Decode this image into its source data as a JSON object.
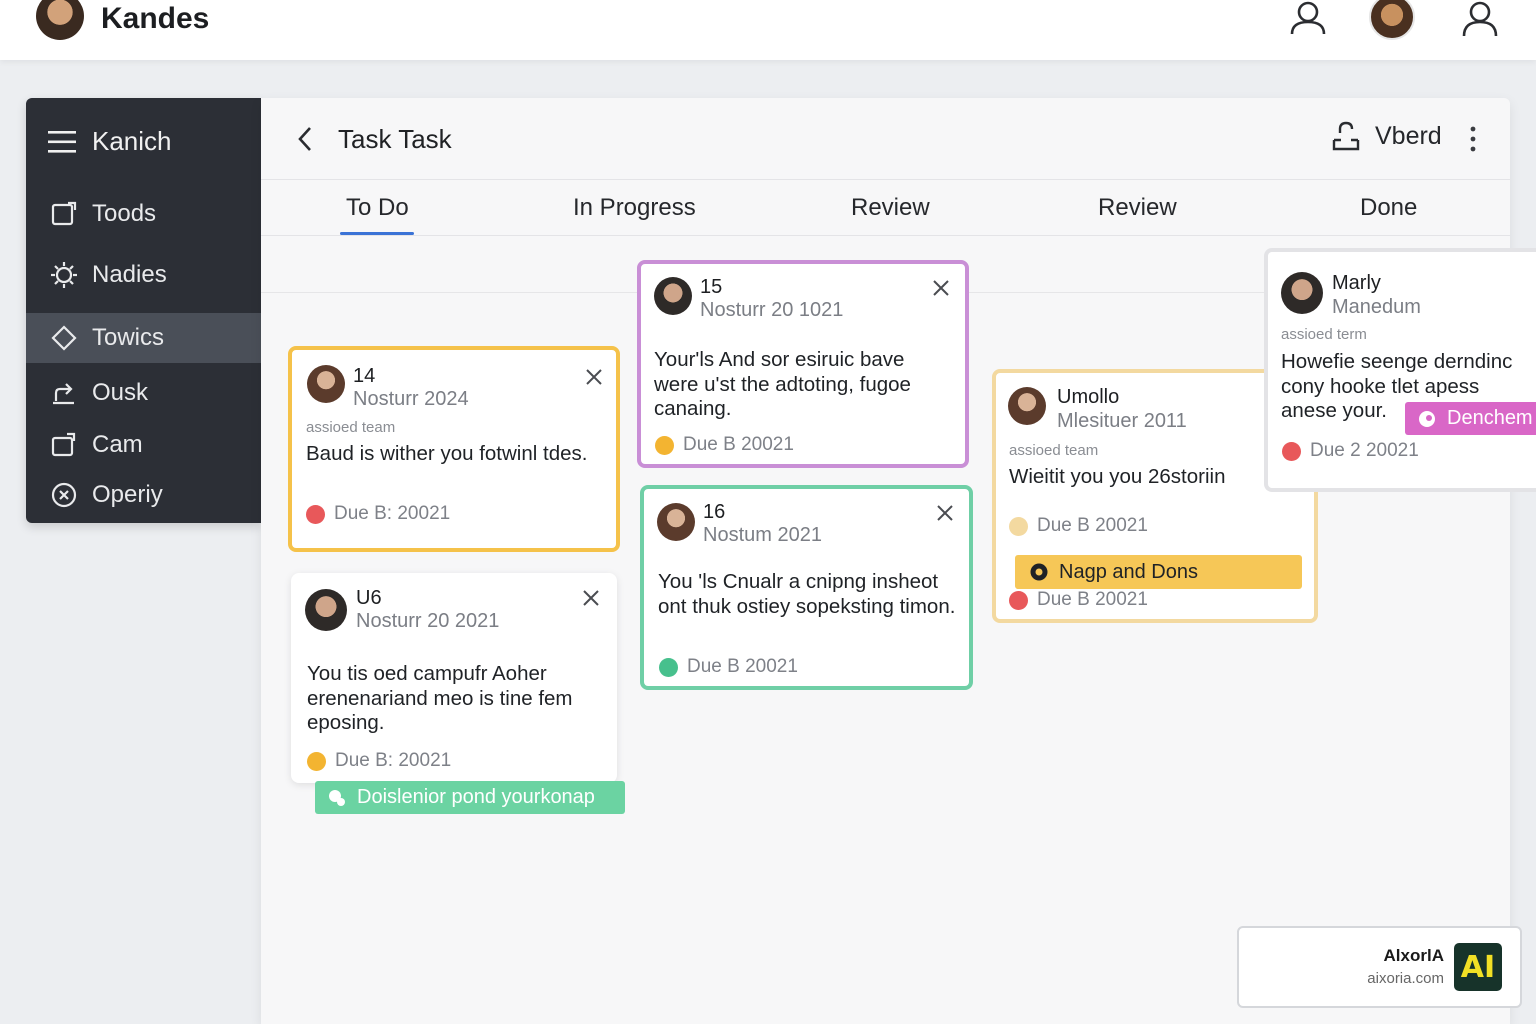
{
  "app": {
    "brand": "Kandes"
  },
  "sidebar": {
    "title": "Kanich",
    "items": [
      {
        "label": "Toods",
        "icon": "edit-icon"
      },
      {
        "label": "Nadies",
        "icon": "gear-icon"
      },
      {
        "label": "Towics",
        "icon": "diamond-icon",
        "active": true
      },
      {
        "label": "Ousk",
        "icon": "share-icon"
      },
      {
        "label": "Cam",
        "icon": "edit-icon"
      },
      {
        "label": "Operiy",
        "icon": "close-circle-icon"
      }
    ]
  },
  "panel": {
    "title": "Task Task",
    "share_label": "Vberd"
  },
  "tabs": [
    "To Do",
    "In Progress",
    "Review",
    "Review",
    "Done"
  ],
  "cards": {
    "c14": {
      "id": "14",
      "sub": "Nosturr 2024",
      "team": "assioed team",
      "body": "Baud is wither you fotwinl tdes.",
      "due": "Due B: 20021"
    },
    "u6": {
      "id": "U6",
      "sub": "Nosturr 20 2021",
      "body": "You tis oed campufr Aoher erenenariand meo is tine fem eposing.",
      "due": "Due B: 20021",
      "tag": "Doislenior pond yourkonap"
    },
    "c15": {
      "id": "15",
      "sub": "Nosturr 20 1021",
      "body": "Your'ls And sor esiruic bave were u'st the adtoting, fugoe canaing.",
      "due": "Due B 20021"
    },
    "c16": {
      "id": "16",
      "sub": "Nostum 2021",
      "body": "You 'ls Cnualr a cnipng insheot ont thuk ostiey sopeksting timon.",
      "due": "Due B 20021"
    },
    "umollo": {
      "id": "Umollo",
      "sub": "Mlesituer 2011",
      "team": "assioed team",
      "body": "Wieitit you you 26storiin",
      "due1": "Due B 20021",
      "tag": "Nagp and Dons",
      "due2": "Due B 20021"
    },
    "marly": {
      "id": "Marly",
      "sub": "Manedum",
      "team": "assioed term",
      "body": "Howefie seenge derndinc cony hooke tlet apess anese your.",
      "tag": "Denchem",
      "due": "Due 2 20021"
    }
  },
  "colors": {
    "accent": "#3b73d6",
    "yellow": "#f5c24a",
    "purple": "#c98fd6",
    "green": "#6fcfa6",
    "tan": "#f3d9a0",
    "red": "#e8585a",
    "orange": "#f3b431",
    "teal": "#47c08d",
    "pink": "#d967c7",
    "mint": "#6bd3a2"
  },
  "watermark": {
    "name": "AlxorlA",
    "url": "aixoria.com",
    "logo": "AI"
  }
}
